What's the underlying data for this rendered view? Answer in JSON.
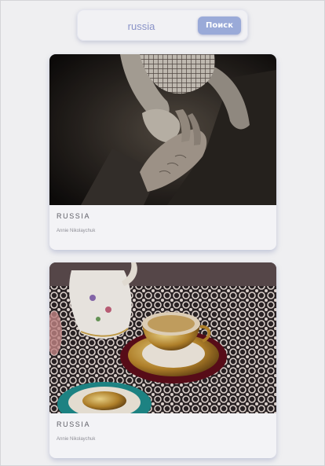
{
  "search": {
    "value": "russia",
    "button_label": "Поиск"
  },
  "cards": [
    {
      "title": "RUSSIA",
      "author": "Annie Nikolaychuk",
      "image": "baby-and-grandparent-hands-photo"
    },
    {
      "title": "RUSSIA",
      "author": "Annie Nikolaychuk",
      "image": "porcelain-teacups-on-lace-photo"
    }
  ],
  "colors": {
    "accent": "#9aaad8",
    "background": "#efeff1",
    "card": "#f3f3f6"
  }
}
